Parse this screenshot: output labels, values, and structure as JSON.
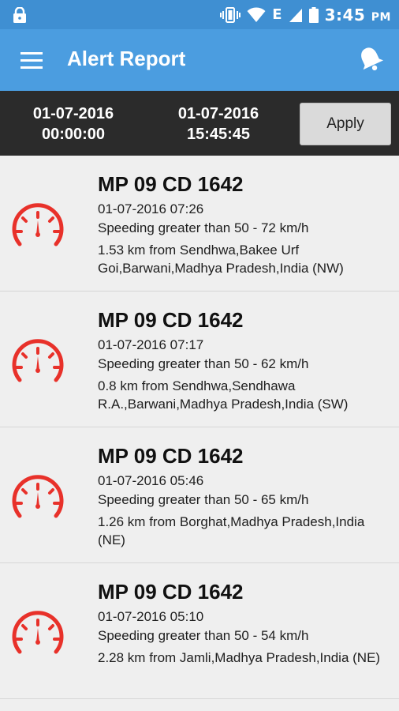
{
  "status": {
    "time": "3:45",
    "ampm": "PM",
    "network": "E"
  },
  "header": {
    "title": "Alert Report"
  },
  "filter": {
    "from_date": "01-07-2016",
    "from_time": "00:00:00",
    "to_date": "01-07-2016",
    "to_time": "15:45:45",
    "apply_label": "Apply"
  },
  "alerts": [
    {
      "vehicle": "MP 09 CD 1642",
      "datetime": "01-07-2016 07:26",
      "message": "Speeding greater than 50 - 72 km/h",
      "location": "1.53 km from Sendhwa,Bakee Urf Goi,Barwani,Madhya Pradesh,India (NW)"
    },
    {
      "vehicle": "MP 09 CD 1642",
      "datetime": "01-07-2016 07:17",
      "message": "Speeding greater than 50 - 62 km/h",
      "location": "0.8 km from Sendhwa,Sendhawa R.A.,Barwani,Madhya Pradesh,India (SW)"
    },
    {
      "vehicle": "MP 09 CD 1642",
      "datetime": "01-07-2016 05:46",
      "message": "Speeding greater than 50 - 65 km/h",
      "location": "1.26 km from Borghat,Madhya Pradesh,India (NE)"
    },
    {
      "vehicle": "MP 09 CD 1642",
      "datetime": "01-07-2016 05:10",
      "message": "Speeding greater than 50 - 54 km/h",
      "location": "2.28 km from Jamli,Madhya Pradesh,India (NE)"
    }
  ],
  "colors": {
    "appbar": "#4b9de0",
    "statusbar": "#3f8fd2",
    "filterbar": "#2b2b2b",
    "gauge": "#e8312a"
  },
  "icons": {
    "menu": "hamburger-menu-icon",
    "notification": "bell-icon",
    "alert": "speedometer-icon"
  }
}
